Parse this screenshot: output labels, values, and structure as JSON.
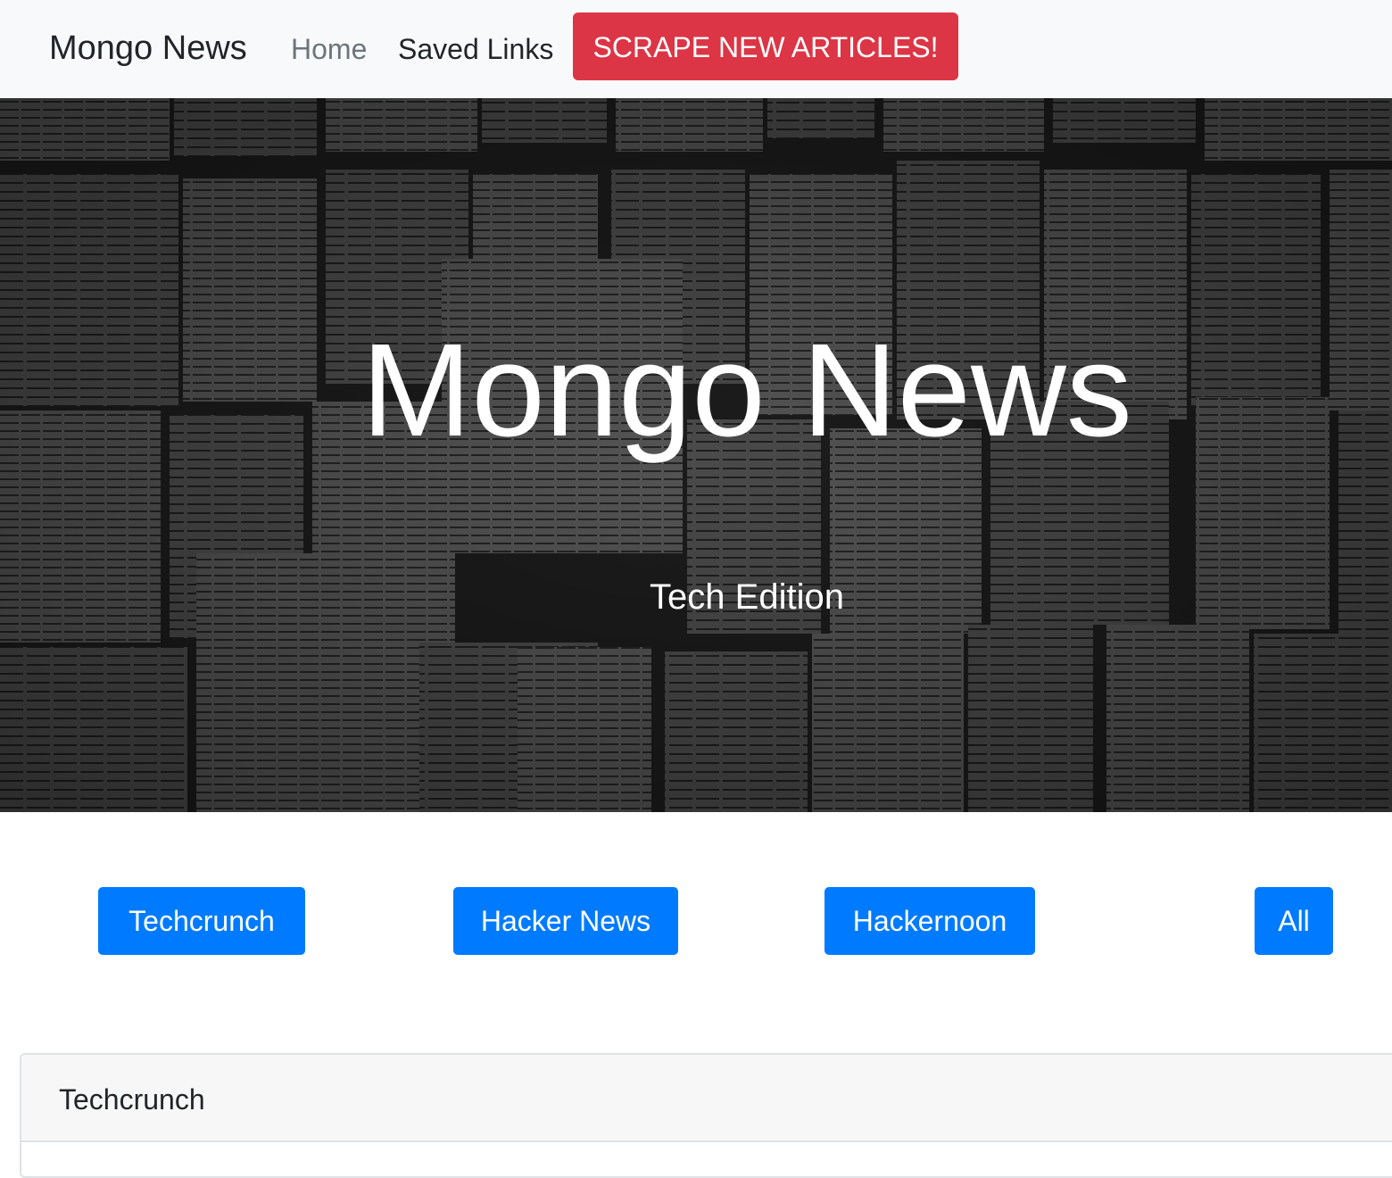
{
  "navbar": {
    "brand": "Mongo News",
    "links": [
      "Home",
      "Saved Links"
    ],
    "scrape_label": "SCRAPE NEW ARTICLES!",
    "scrape_color": "#dc3545"
  },
  "hero": {
    "title": "Mongo News",
    "subtitle": "Tech Edition"
  },
  "filters": {
    "buttons": [
      "Techcrunch",
      "Hacker News",
      "Hackernoon",
      "All"
    ],
    "color": "#007bff"
  },
  "section": {
    "title": "Techcrunch"
  }
}
